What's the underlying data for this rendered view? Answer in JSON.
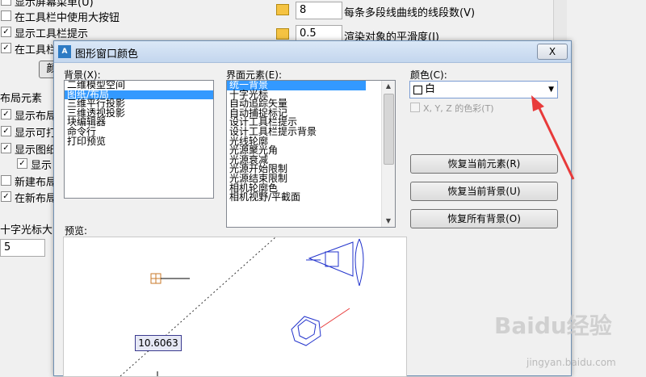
{
  "background_window": {
    "left_checks": [
      {
        "label": "显示屏幕菜单(U)",
        "checked": false
      },
      {
        "label": "在工具栏中使用大按钮",
        "checked": false
      },
      {
        "label": "显示工具栏提示",
        "checked": true
      },
      {
        "label": "在工具栏",
        "checked": true
      }
    ],
    "color_button_label": "颜",
    "layout_section_title": "布局元素",
    "layout_checks": [
      {
        "label": "显示布局",
        "checked": true
      },
      {
        "label": "显示可打",
        "checked": true
      },
      {
        "label": "显示图纸",
        "checked": true
      },
      {
        "label": "显示",
        "checked": true
      }
    ],
    "new_layout_checks": [
      {
        "label": "新建布局",
        "checked": false
      },
      {
        "label": "在新布局",
        "checked": true
      }
    ],
    "crosshair_label": "十字光标大",
    "crosshair_value": "5",
    "segments_value": "8",
    "segments_label": "每条多段线曲线的线段数(V)",
    "smoothness_value": "0.5",
    "smoothness_label": "渲染对象的平滑度(J)"
  },
  "dialog": {
    "title": "图形窗口颜色",
    "icon_label": "A",
    "close_label": "X",
    "context_label": "背景(X):",
    "context_items": [
      "二维模型空间",
      "图纸/布局",
      "三维平行投影",
      "三维透视投影",
      "块编辑器",
      "命令行",
      "打印预览"
    ],
    "context_selected": 1,
    "element_label": "界面元素(E):",
    "element_items": [
      "统一背景",
      "十字光标",
      "自动追踪矢量",
      "自动捕捉标记",
      "设计工具栏提示",
      "设计工具栏提示背景",
      "光线轮廓",
      "光源聚光角",
      "光源衰减",
      "光源开始限制",
      "光源结束限制",
      "相机轮廓色",
      "相机视野/平截面"
    ],
    "element_selected": 0,
    "color_label": "颜色(C):",
    "color_value": "白",
    "xyz_label": "X, Y, Z 的色彩(T)",
    "btn_restore_element": "恢复当前元素(R)",
    "btn_restore_context": "恢复当前背景(U)",
    "btn_restore_all": "恢复所有背景(O)",
    "preview_label": "预览:",
    "preview_value": "10.6063"
  },
  "watermark": {
    "text": "Baidu经验",
    "sub": "jingyan.baidu.com"
  },
  "colors": {
    "selection": "#3399ff",
    "arrow": "#e83a3a",
    "preview_blue": "#2233cc"
  }
}
